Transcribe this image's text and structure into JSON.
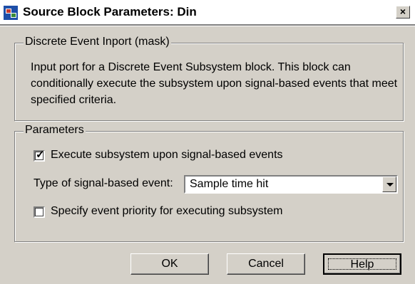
{
  "window": {
    "title": "Source Block Parameters: Din",
    "close_glyph": "×",
    "icon": "simulink-block-icon"
  },
  "description_group": {
    "legend": "Discrete Event Inport (mask)",
    "text": "Input port for a Discrete Event Subsystem block. This block can conditionally execute the subsystem upon signal-based events that meet specified criteria."
  },
  "parameters_group": {
    "legend": "Parameters",
    "execute_checkbox": {
      "label": "Execute subsystem upon signal-based events",
      "checked": true,
      "mark": "✓"
    },
    "event_type": {
      "label": "Type of signal-based event:",
      "selected": "Sample time hit"
    },
    "priority_checkbox": {
      "label": "Specify event priority for executing subsystem",
      "checked": false
    }
  },
  "buttons": {
    "ok": "OK",
    "cancel": "Cancel",
    "help": "Help"
  },
  "colors": {
    "face": "#d4d0c8",
    "title_bg": "#ffffff"
  }
}
